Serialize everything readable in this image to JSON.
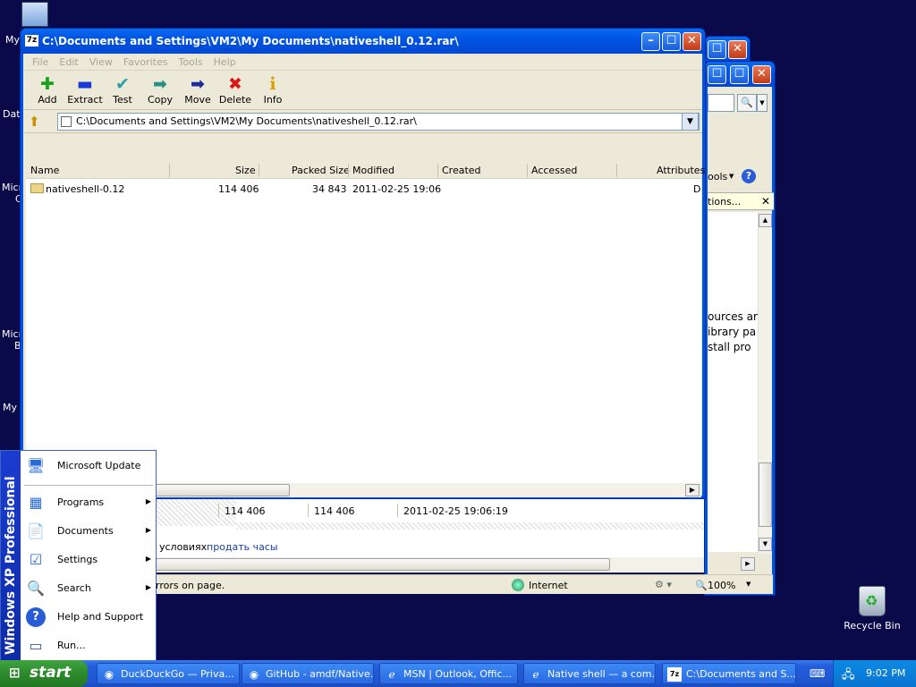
{
  "desktop": {
    "icons": [
      {
        "label": "My"
      },
      {
        "label": "Dat"
      },
      {
        "label": "Micro"
      },
      {
        "label": "C"
      },
      {
        "label": "Micro"
      },
      {
        "label": "B"
      },
      {
        "label": "My I"
      }
    ],
    "recycle_bin": "Recycle Bin"
  },
  "sevenzip": {
    "title": "C:\\Documents and Settings\\VM2\\My Documents\\nativeshell_0.12.rar\\",
    "app_badge": "7z",
    "menu": [
      "File",
      "Edit",
      "View",
      "Favorites",
      "Tools",
      "Help"
    ],
    "toolbar": [
      {
        "label": "Add",
        "icon": "add-icon"
      },
      {
        "label": "Extract",
        "icon": "extract-icon"
      },
      {
        "label": "Test",
        "icon": "test-icon"
      },
      {
        "label": "Copy",
        "icon": "copy-icon"
      },
      {
        "label": "Move",
        "icon": "move-icon"
      },
      {
        "label": "Delete",
        "icon": "delete-icon"
      },
      {
        "label": "Info",
        "icon": "info-icon"
      }
    ],
    "address": "C:\\Documents and Settings\\VM2\\My Documents\\nativeshell_0.12.rar\\",
    "columns": [
      "Name",
      "Size",
      "Packed Size",
      "Modified",
      "Created",
      "Accessed",
      "Attributes"
    ],
    "rows": [
      {
        "name": "nativeshell-0.12",
        "size": "114 406",
        "packed": "34 843",
        "modified": "2011-02-25 19:06",
        "created": "",
        "accessed": "",
        "attributes": "D"
      }
    ],
    "status": {
      "size": "114 406",
      "packed": "114 406",
      "modified": "2011-02-25 19:06:19"
    }
  },
  "ie_background": {
    "menu_tools": "ools",
    "info_bar": "tions...",
    "text_lines": [
      "ources ar",
      "ibrary pa",
      "stall pro"
    ],
    "link_text_prefix": "условиях",
    "link_text": "продать часы",
    "status_text": "rrors on page.",
    "zone": "Internet",
    "zoom": "100%"
  },
  "start_menu": {
    "side_text": "Windows XP Professional",
    "items": [
      {
        "label": "Microsoft Update",
        "icon": "windows-update-icon",
        "submenu": false
      },
      {
        "label": "Programs",
        "icon": "programs-icon",
        "submenu": true
      },
      {
        "label": "Documents",
        "icon": "documents-icon",
        "submenu": true
      },
      {
        "label": "Settings",
        "icon": "settings-icon",
        "submenu": true
      },
      {
        "label": "Search",
        "icon": "search-icon",
        "submenu": true
      },
      {
        "label": "Help and Support",
        "icon": "help-icon",
        "submenu": false
      },
      {
        "label": "Run...",
        "icon": "run-icon",
        "submenu": false
      }
    ]
  },
  "taskbar": {
    "start": "start",
    "tasks": [
      {
        "label": "DuckDuckGo — Priva...",
        "icon": "firefox-icon"
      },
      {
        "label": "GitHub - amdf/Native...",
        "icon": "firefox-icon"
      },
      {
        "label": "MSN | Outlook, Offic...",
        "icon": "ie-icon"
      },
      {
        "label": "Native shell — a com...",
        "icon": "ie-icon"
      },
      {
        "label": "C:\\Documents and S...",
        "icon": "7zip-icon"
      }
    ],
    "clock": "9:02 PM"
  }
}
